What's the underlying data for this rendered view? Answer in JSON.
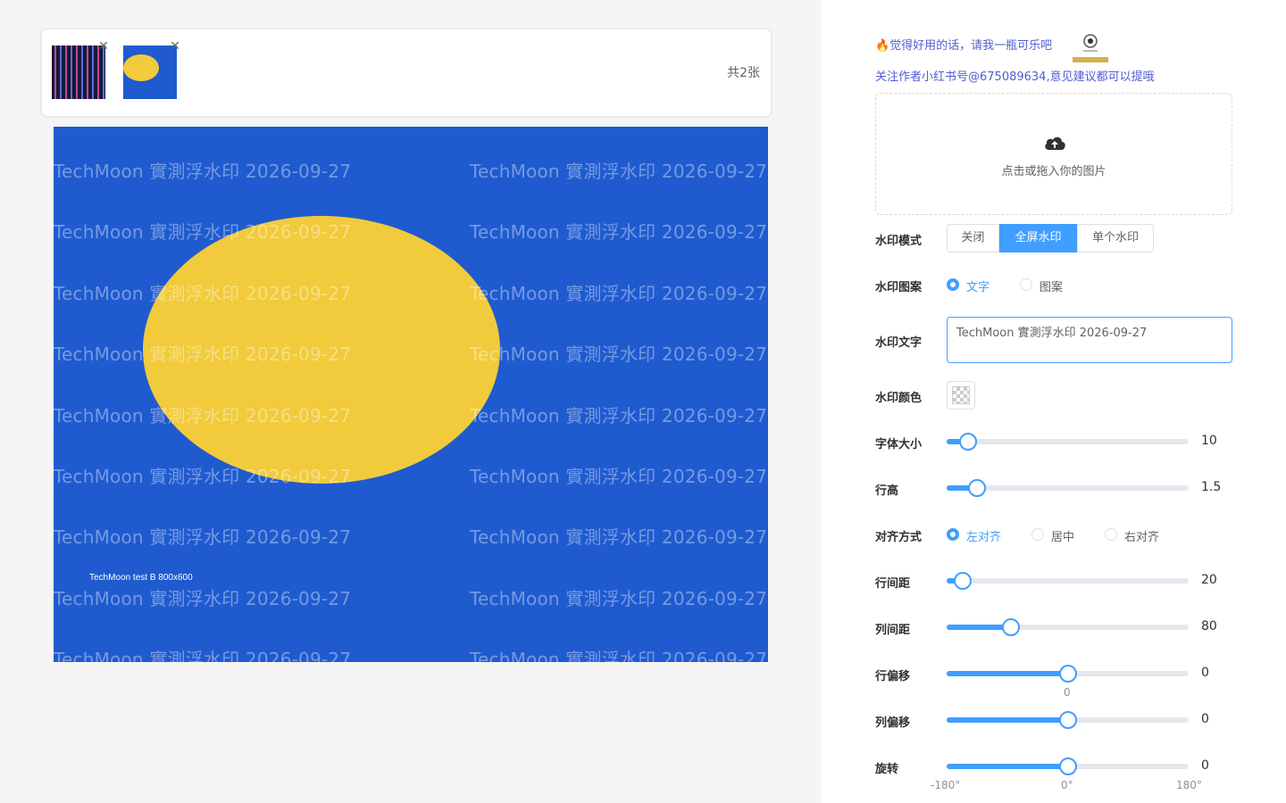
{
  "thumbnails": [
    {
      "name": "stripes"
    },
    {
      "name": "yellow-ellipse"
    }
  ],
  "thumb_count": "共2张",
  "preview": {
    "caption": "TechMoon test B 800x600",
    "watermark_text": "TechMoon 實測浮水印 2026-09-27",
    "background_color": "#1f5bcf",
    "ellipse_color": "#f1cb3c"
  },
  "promo": {
    "text": "🔥觉得好用的话，请我一瓶可乐吧",
    "follow": "关注作者小红书号@675089634,意见建议都可以提哦"
  },
  "upload": {
    "icon": "cloud-upload-icon",
    "text": "点击或拖入你的图片"
  },
  "settings": {
    "mode": {
      "label": "水印模式",
      "options": [
        "关闭",
        "全屏水印",
        "单个水印"
      ],
      "selected": "全屏水印"
    },
    "pattern": {
      "label": "水印图案",
      "options": [
        "文字",
        "图案"
      ],
      "selected": "文字"
    },
    "text": {
      "label": "水印文字",
      "value": "TechMoon 實測浮水印 2026-09-27"
    },
    "color": {
      "label": "水印颜色"
    },
    "font_size": {
      "label": "字体大小",
      "value": "10",
      "fraction": 0.09
    },
    "line_height": {
      "label": "行高",
      "value": "1.5",
      "fraction": 0.125
    },
    "align": {
      "label": "对齐方式",
      "options": [
        "左对齐",
        "居中",
        "右对齐"
      ],
      "selected": "左对齐"
    },
    "row_gap": {
      "label": "行间距",
      "value": "20",
      "fraction": 0.065
    },
    "col_gap": {
      "label": "列间距",
      "value": "80",
      "fraction": 0.265
    },
    "row_offset": {
      "label": "行偏移",
      "value": "0",
      "fraction": 0.5,
      "marker": "0"
    },
    "col_offset": {
      "label": "列偏移",
      "value": "0",
      "fraction": 0.5
    },
    "rotation": {
      "label": "旋转",
      "value": "0",
      "fraction": 0.5,
      "marks": [
        "-180°",
        "0°",
        "180°"
      ]
    }
  },
  "colors": {
    "accent": "#409eff",
    "promo": "#4e5ed3"
  }
}
